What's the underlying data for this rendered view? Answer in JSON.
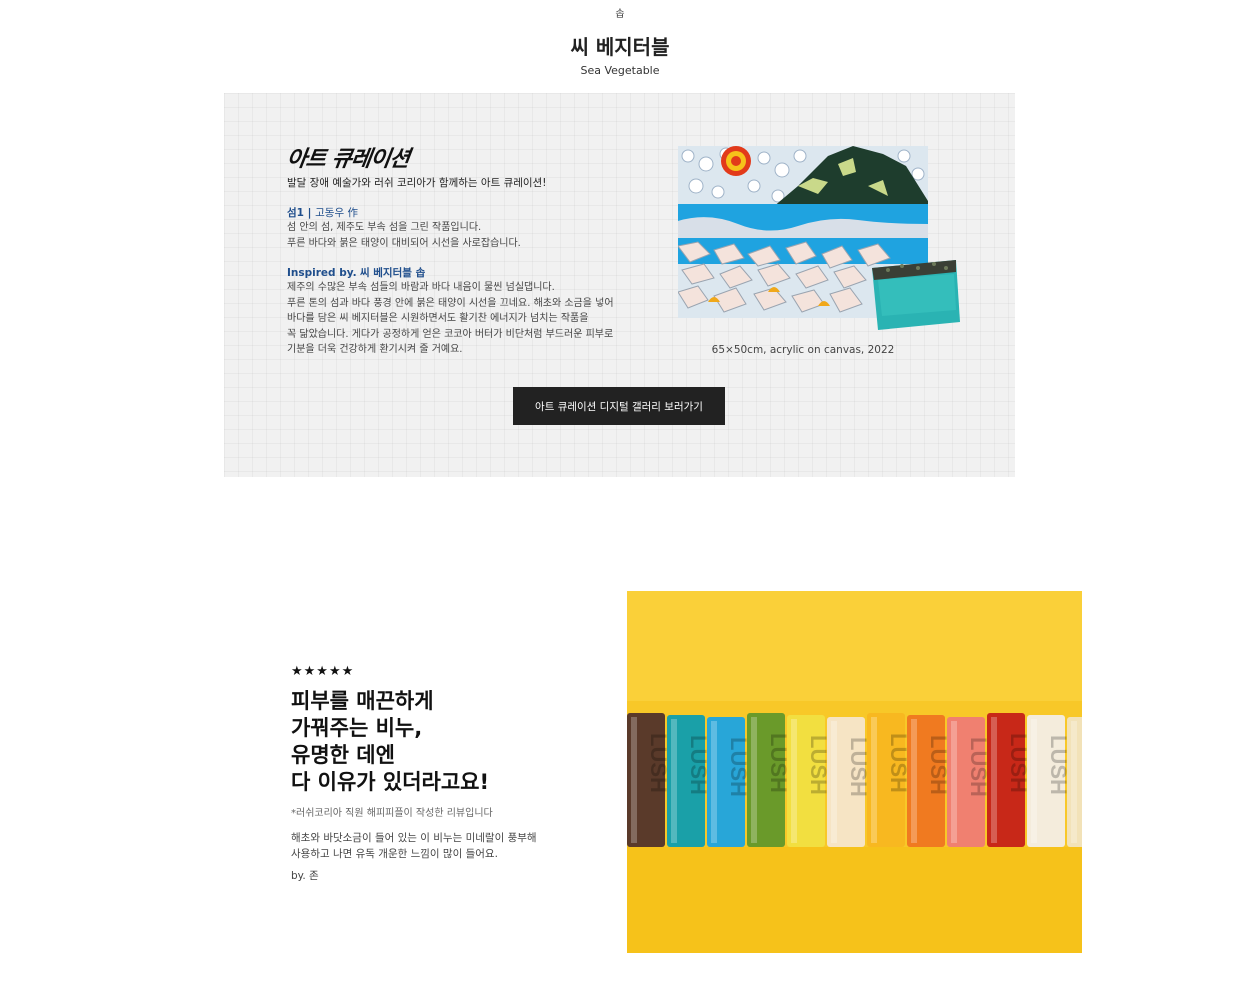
{
  "header": {
    "breadcrumb": "솝",
    "title": "씨 베지터블",
    "subtitle": "Sea Vegetable"
  },
  "art_curation": {
    "heading": "아트 큐레이션",
    "description": "발달 장애 예술가와 러쉬 코리아가 함께하는 아트 큐레이션!",
    "work_title_prefix": "섬1",
    "work_title_sep": " | ",
    "work_title_artist": "고동우 作",
    "work_lines": [
      "섬 안의 섬, 제주도 부속 섬을 그린 작품입니다.",
      "푸른 바다와 붉은 태양이 대비되어 시선을 사로잡습니다."
    ],
    "inspired_prefix": "Inspired by.",
    "inspired_product": "씨 베지터블 솝",
    "inspired_lines": [
      "제주의 수많은 부속 섬들의 바람과 바다 내음이 물씬 넘실댑니다.",
      "푸른 톤의 섬과 바다 풍경 안에 붉은 태양이 시선을 끄네요. 해초와 소금을 넣어",
      "바다를 담은 씨 베지터블은 시원하면서도 활기찬 에너지가 넘치는 작품을",
      "꼭 닮았습니다. 게다가 공정하게 얻은 코코아 버터가 비단처럼 부드러운 피부로",
      "기분을 더욱 건강하게 환기시켜 줄 거예요."
    ],
    "caption": "65×50cm, acrylic on canvas, 2022",
    "button_label": "아트 큐레이션 디지털 갤러리 보러가기"
  },
  "review": {
    "stars": "★★★★★",
    "rating": 5,
    "heading_lines": [
      "피부를 매끈하게",
      "가꿔주는 비누,",
      "유명한 데엔",
      "다 이유가 있더라고요!"
    ],
    "note": "*러쉬코리아 직원 해피피플이 작성한 리뷰입니다",
    "body_lines": [
      "해초와 바닷소금이 들어 있는 이 비누는 미네랄이 풍부해",
      "사용하고 나면 유독 개운한 느낌이 많이 들어요."
    ],
    "author": "by. 존"
  },
  "soap_photo": {
    "bar_colors": [
      "#5a3a2a",
      "#1aa0a8",
      "#28a6d8",
      "#6a9a2a",
      "#f2df40",
      "#f6e4c4",
      "#f8b820",
      "#f07a20",
      "#f08070",
      "#c82818",
      "#f4ecdc",
      "#f2e2b8"
    ],
    "bar_text": "LUSH",
    "background_color": "#f8c828"
  },
  "colors": {
    "accent_blue": "#1f4e8c",
    "button_bg": "#222222"
  }
}
